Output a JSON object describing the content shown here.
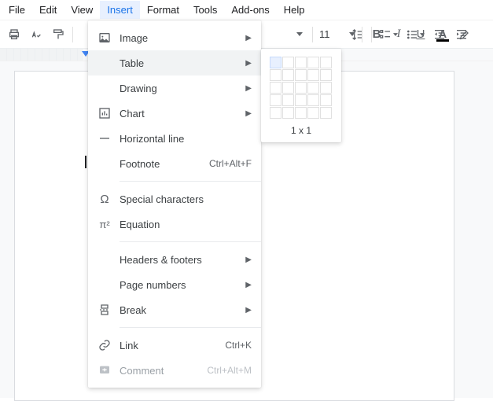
{
  "menubar": {
    "file": "File",
    "edit": "Edit",
    "view": "View",
    "insert": "Insert",
    "format": "Format",
    "tools": "Tools",
    "addons": "Add-ons",
    "help": "Help"
  },
  "toolbar": {
    "font_size": "11"
  },
  "insert_menu": {
    "image": "Image",
    "table": "Table",
    "drawing": "Drawing",
    "chart": "Chart",
    "hline": "Horizontal line",
    "footnote": "Footnote",
    "footnote_shortcut": "Ctrl+Alt+F",
    "special_chars": "Special characters",
    "equation": "Equation",
    "headers_footers": "Headers & footers",
    "page_numbers": "Page numbers",
    "break": "Break",
    "link": "Link",
    "link_shortcut": "Ctrl+K",
    "comment": "Comment",
    "comment_shortcut": "Ctrl+Alt+M"
  },
  "table_submenu": {
    "size_label": "1 x 1"
  }
}
